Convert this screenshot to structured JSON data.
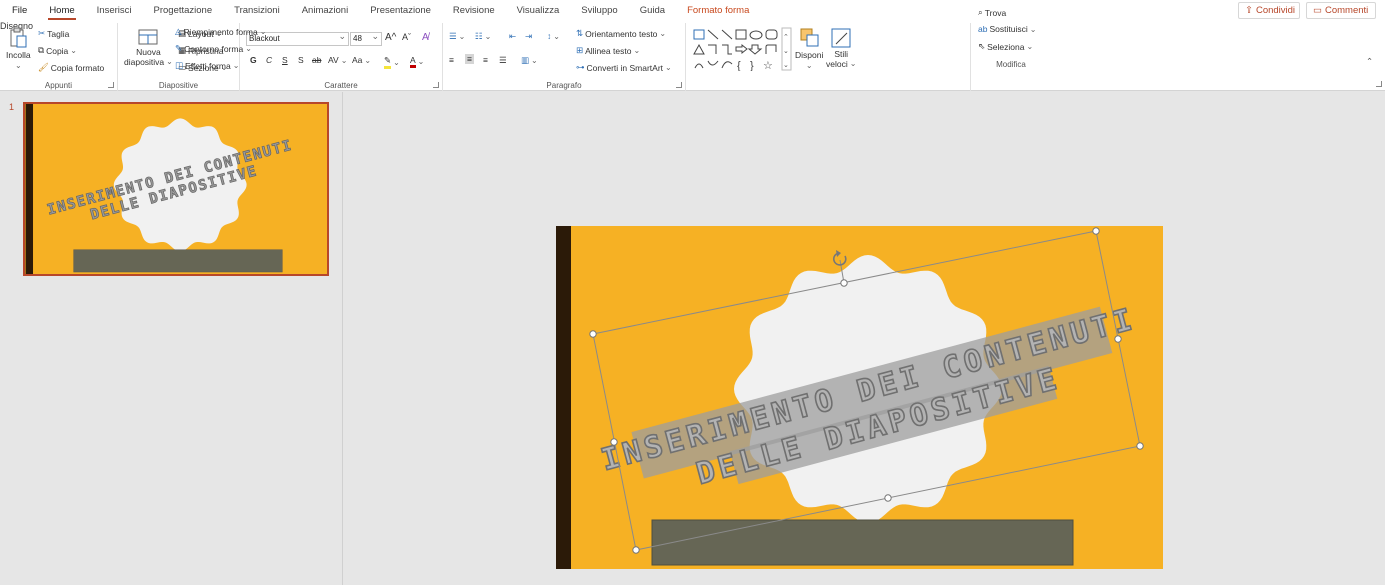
{
  "menu": {
    "tabs": [
      "File",
      "Home",
      "Inserisci",
      "Progettazione",
      "Transizioni",
      "Animazioni",
      "Presentazione",
      "Revisione",
      "Visualizza",
      "Sviluppo",
      "Guida",
      "Formato forma"
    ],
    "share_label": "Condividi",
    "comments_label": "Commenti"
  },
  "ribbon": {
    "clipboard": {
      "paste": "Incolla",
      "cut": "Taglia",
      "copy": "Copia",
      "format_painter": "Copia formato",
      "label": "Appunti"
    },
    "slides": {
      "new_slide_1": "Nuova",
      "new_slide_2": "diapositiva",
      "layout": "Layout",
      "reset": "Ripristina",
      "section": "Sezione",
      "label": "Diapositive"
    },
    "font": {
      "family": "Blackout",
      "size": "48",
      "bold": "G",
      "italic": "C",
      "underline": "S",
      "shadow": "S",
      "case": "Aa",
      "label": "Carattere"
    },
    "paragraph": {
      "text_direction": "Orientamento testo",
      "align_text": "Allinea testo",
      "smartart": "Converti in SmartArt",
      "label": "Paragrafo"
    },
    "drawing": {
      "arrange": "Disponi",
      "quick_styles_1": "Stili",
      "quick_styles_2": "veloci",
      "fill": "Riempimento forma",
      "outline": "Contorno forma",
      "effects": "Effetti forma",
      "label": "Disegno"
    },
    "editing": {
      "find": "Trova",
      "replace": "Sostituisci",
      "select": "Seleziona",
      "label": "Modifica"
    }
  },
  "thumbnails": [
    {
      "number": "1"
    }
  ],
  "slide": {
    "title_line1": "INSERIMENTO DEI CONTENUTI",
    "title_line2": "DELLE DIAPOSITIVE"
  },
  "colors": {
    "slide_bg": "#f6b124",
    "accent": "#b7472a",
    "left_bar": "#2b1a08",
    "bottom_box": "#666655",
    "badge": "#f1f1f1"
  }
}
